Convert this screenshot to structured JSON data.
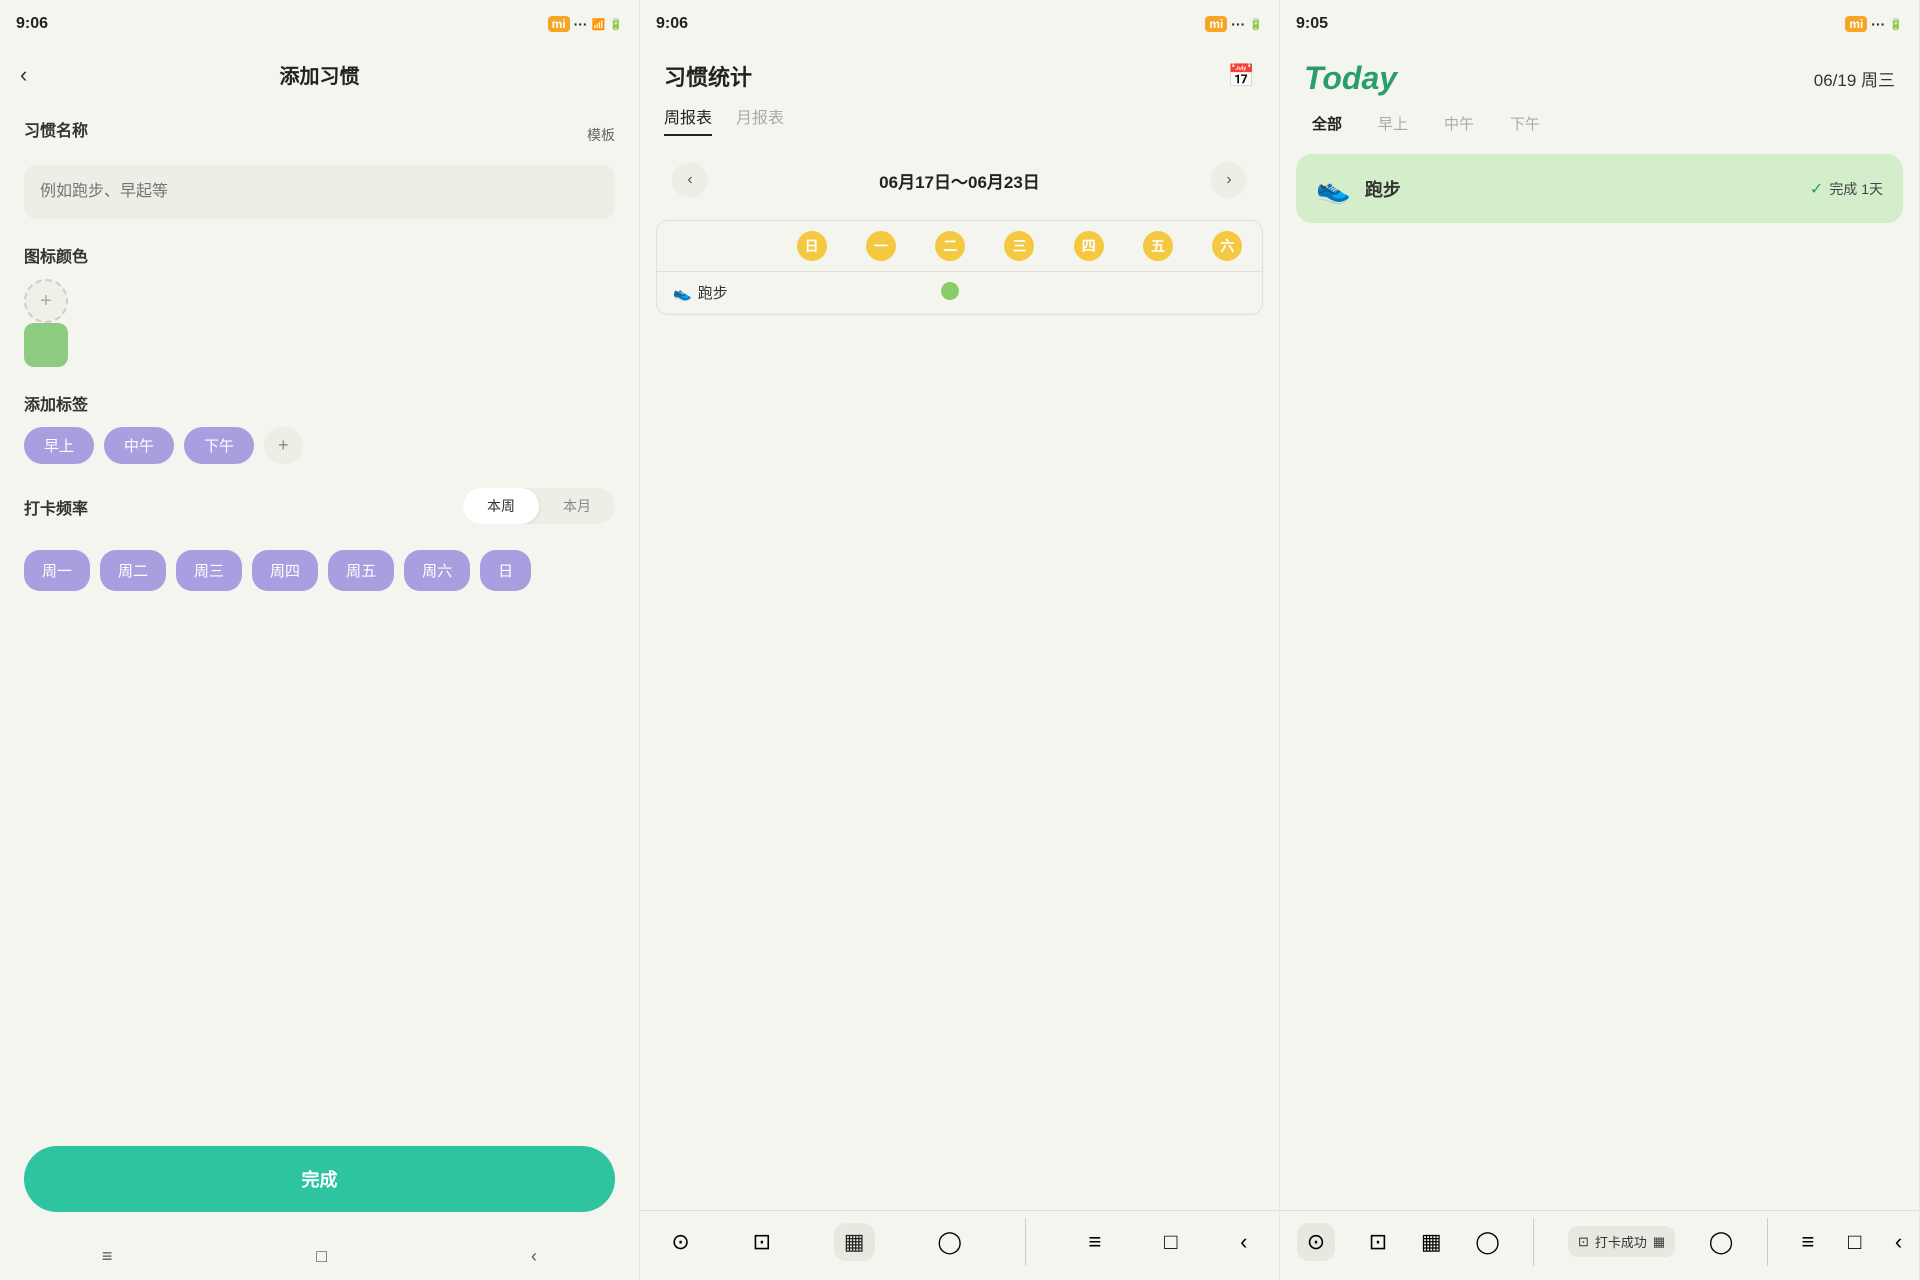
{
  "panel1": {
    "status_time": "9:06",
    "title": "添加习惯",
    "back": "‹",
    "section_habit_name": "习惯名称",
    "template_label": "模板",
    "input_placeholder": "例如跑步、早起等",
    "section_icon_color": "图标颜色",
    "color_green": "#8dcc80",
    "section_tags": "添加标签",
    "tags": [
      "早上",
      "中午",
      "下午"
    ],
    "section_freq": "打卡频率",
    "freq_week": "本周",
    "freq_month": "本月",
    "days": [
      "周一",
      "周二",
      "周三",
      "周四",
      "周五",
      "周六"
    ],
    "done_btn": "完成"
  },
  "panel2": {
    "status_time": "9:06",
    "title": "习惯统计",
    "tab_week": "周报表",
    "tab_month": "月报表",
    "week_range": "06月17日～06月23日",
    "days_header": [
      "日",
      "一",
      "二",
      "三",
      "四",
      "五",
      "六"
    ],
    "habit_row": {
      "icon": "👟",
      "name": "跑步",
      "checks": [
        false,
        false,
        true,
        false,
        false,
        false,
        false
      ]
    }
  },
  "panel3": {
    "status_time": "9:05",
    "title": "Today",
    "date": "06/19 周三",
    "filters": [
      "全部",
      "早上",
      "中午",
      "下午"
    ],
    "habit": {
      "icon": "👟",
      "name": "跑步",
      "complete_label": "完成 1天"
    },
    "checkin_label": "打卡成功"
  },
  "nav": {
    "menu": "≡",
    "square": "□",
    "back": "‹"
  }
}
